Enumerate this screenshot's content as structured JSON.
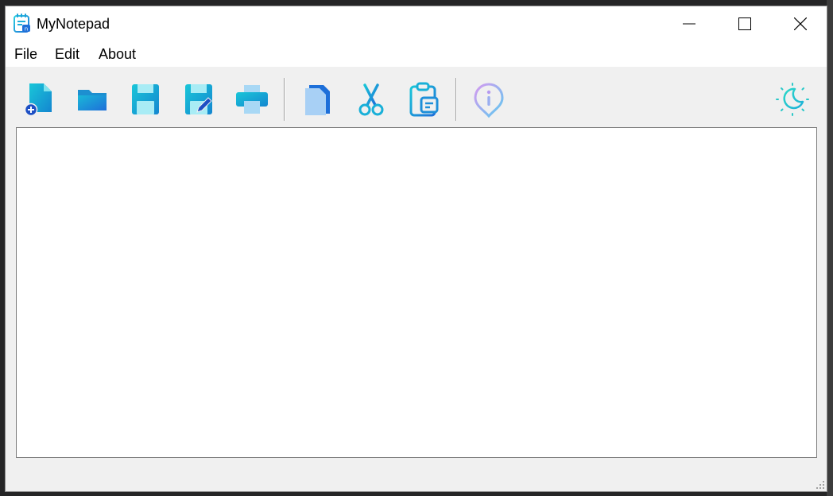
{
  "window": {
    "title": "MyNotepad",
    "app_icon": "notepad-icon"
  },
  "menu": {
    "items": [
      "File",
      "Edit",
      "About"
    ]
  },
  "toolbar": {
    "buttons": [
      {
        "icon": "new-file-icon"
      },
      {
        "icon": "open-folder-icon"
      },
      {
        "icon": "save-icon"
      },
      {
        "icon": "save-as-icon"
      },
      {
        "icon": "print-icon"
      },
      {
        "icon": "copy-icon"
      },
      {
        "icon": "cut-icon"
      },
      {
        "icon": "paste-icon"
      },
      {
        "icon": "about-info-icon"
      },
      {
        "icon": "dark-mode-icon"
      }
    ]
  },
  "editor": {
    "content": ""
  },
  "colors": {
    "accent_teal": "#14b8c8",
    "accent_blue": "#1e6fd9",
    "menubar_bg": "#ffffff",
    "toolbar_bg": "#f0f0f0"
  }
}
